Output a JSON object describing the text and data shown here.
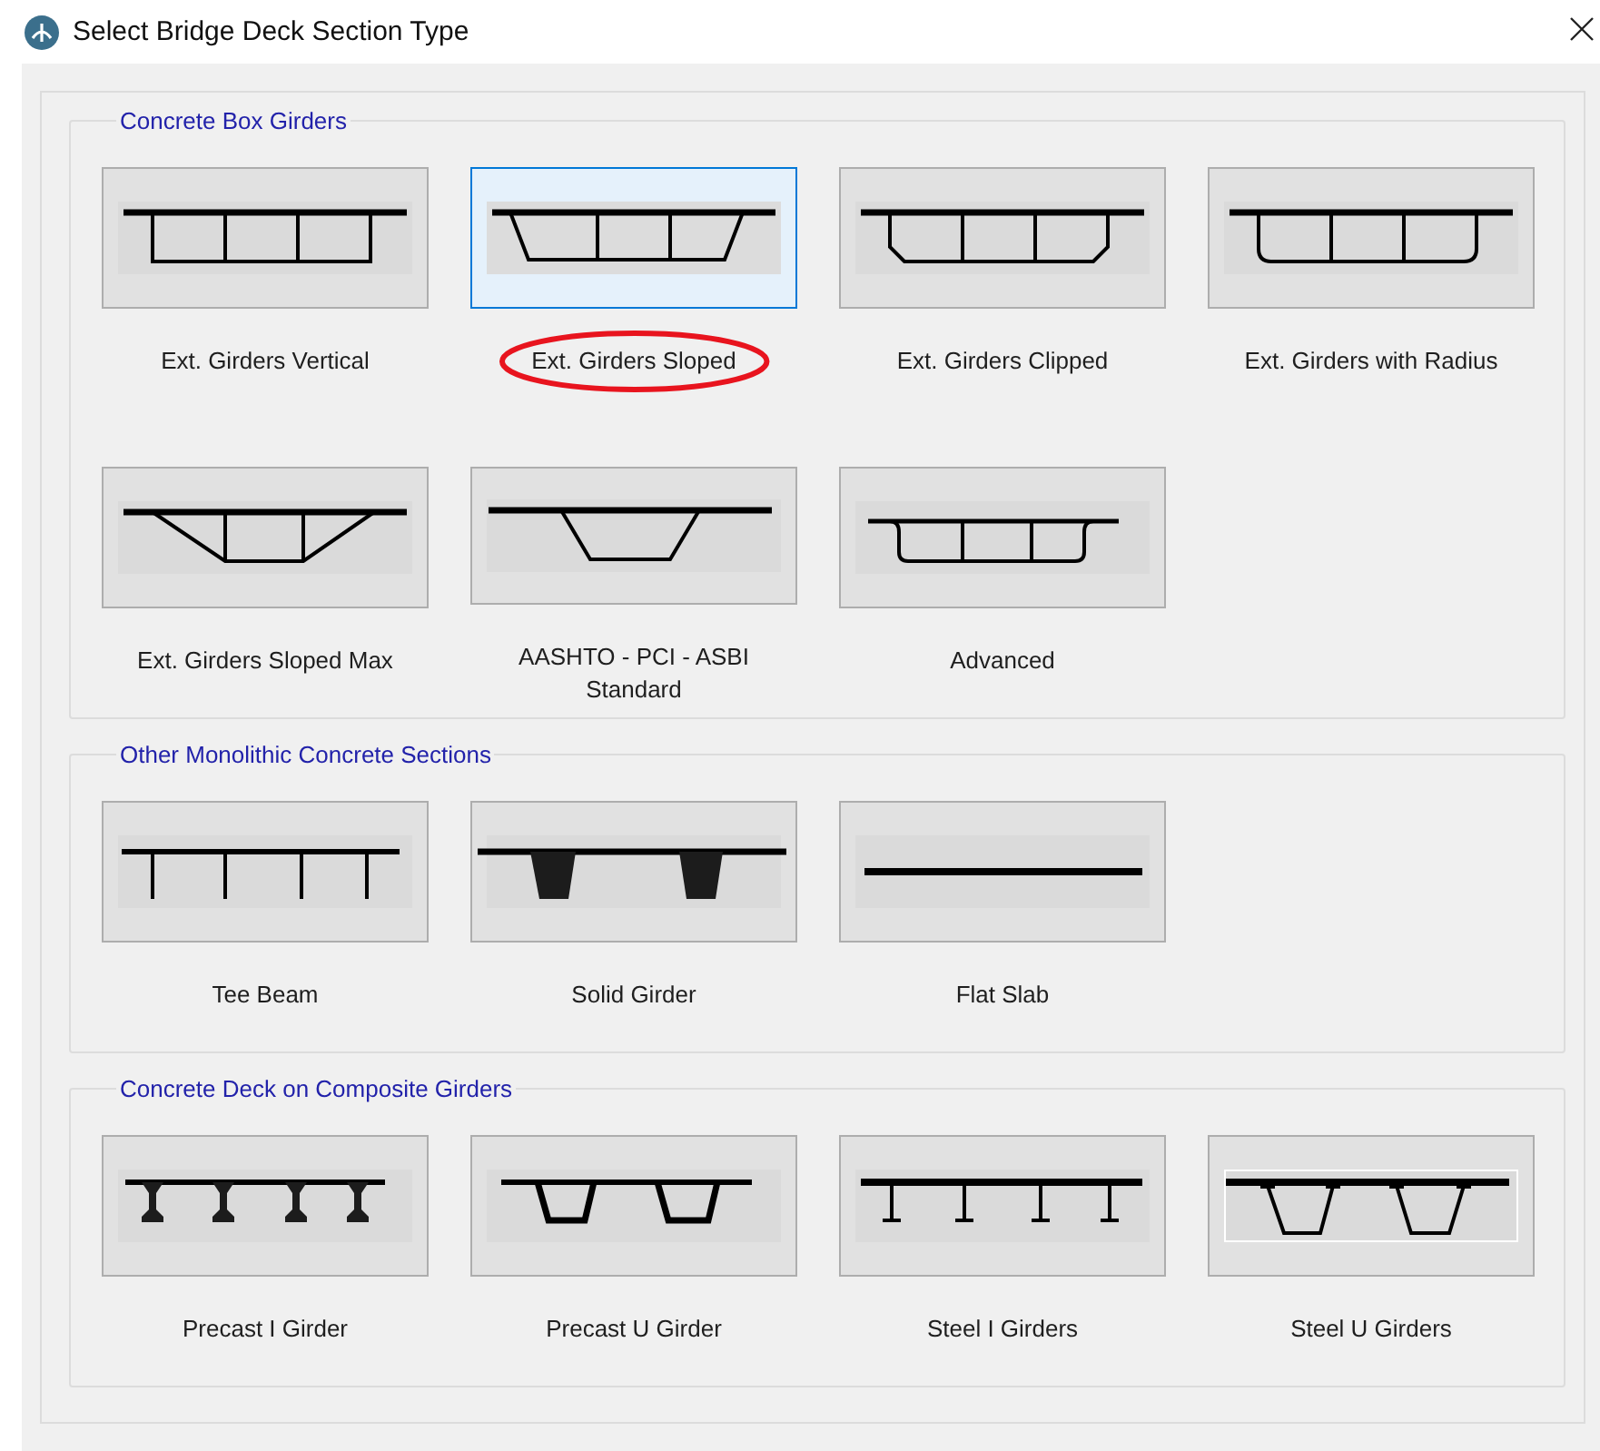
{
  "window": {
    "title": "Select Bridge Deck Section Type"
  },
  "groups": [
    {
      "title": "Concrete Box Girders",
      "items": [
        {
          "label": "Ext. Girders Vertical",
          "kind": "vertical",
          "selected": false,
          "circled": false,
          "focused": false
        },
        {
          "label": "Ext. Girders Sloped",
          "kind": "sloped",
          "selected": true,
          "circled": true,
          "focused": false
        },
        {
          "label": "Ext. Girders Clipped",
          "kind": "clipped",
          "selected": false,
          "circled": false,
          "focused": false
        },
        {
          "label": "Ext. Girders with Radius",
          "kind": "radius",
          "selected": false,
          "circled": false,
          "focused": false
        },
        {
          "label": "Ext. Girders Sloped Max",
          "kind": "sloped-max",
          "selected": false,
          "circled": false,
          "focused": false
        },
        {
          "label": "AASHTO - PCI - ASBI\nStandard",
          "kind": "aashto",
          "selected": false,
          "circled": false,
          "focused": false
        },
        {
          "label": "Advanced",
          "kind": "advanced",
          "selected": false,
          "circled": false,
          "focused": false
        }
      ]
    },
    {
      "title": "Other Monolithic Concrete Sections",
      "items": [
        {
          "label": "Tee Beam",
          "kind": "tee",
          "selected": false,
          "circled": false,
          "focused": false
        },
        {
          "label": "Solid Girder",
          "kind": "solid",
          "selected": false,
          "circled": false,
          "focused": false
        },
        {
          "label": "Flat Slab",
          "kind": "flat",
          "selected": false,
          "circled": false,
          "focused": false
        }
      ]
    },
    {
      "title": "Concrete Deck on Composite Girders",
      "items": [
        {
          "label": "Precast I Girder",
          "kind": "precast-i",
          "selected": false,
          "circled": false,
          "focused": false
        },
        {
          "label": "Precast U Girder",
          "kind": "precast-u",
          "selected": false,
          "circled": false,
          "focused": false
        },
        {
          "label": "Steel I Girders",
          "kind": "steel-i",
          "selected": false,
          "circled": false,
          "focused": false
        },
        {
          "label": "Steel U Girders",
          "kind": "steel-u",
          "selected": false,
          "circled": false,
          "focused": true
        }
      ]
    }
  ]
}
